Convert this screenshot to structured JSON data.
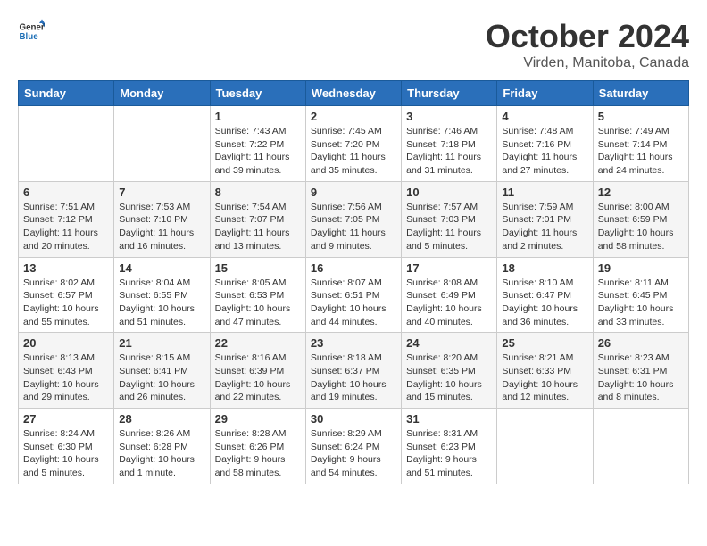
{
  "header": {
    "logo_line1": "General",
    "logo_line2": "Blue",
    "month": "October 2024",
    "location": "Virden, Manitoba, Canada"
  },
  "days_of_week": [
    "Sunday",
    "Monday",
    "Tuesday",
    "Wednesday",
    "Thursday",
    "Friday",
    "Saturday"
  ],
  "weeks": [
    [
      {
        "day": "",
        "info": ""
      },
      {
        "day": "",
        "info": ""
      },
      {
        "day": "1",
        "info": "Sunrise: 7:43 AM\nSunset: 7:22 PM\nDaylight: 11 hours and 39 minutes."
      },
      {
        "day": "2",
        "info": "Sunrise: 7:45 AM\nSunset: 7:20 PM\nDaylight: 11 hours and 35 minutes."
      },
      {
        "day": "3",
        "info": "Sunrise: 7:46 AM\nSunset: 7:18 PM\nDaylight: 11 hours and 31 minutes."
      },
      {
        "day": "4",
        "info": "Sunrise: 7:48 AM\nSunset: 7:16 PM\nDaylight: 11 hours and 27 minutes."
      },
      {
        "day": "5",
        "info": "Sunrise: 7:49 AM\nSunset: 7:14 PM\nDaylight: 11 hours and 24 minutes."
      }
    ],
    [
      {
        "day": "6",
        "info": "Sunrise: 7:51 AM\nSunset: 7:12 PM\nDaylight: 11 hours and 20 minutes."
      },
      {
        "day": "7",
        "info": "Sunrise: 7:53 AM\nSunset: 7:10 PM\nDaylight: 11 hours and 16 minutes."
      },
      {
        "day": "8",
        "info": "Sunrise: 7:54 AM\nSunset: 7:07 PM\nDaylight: 11 hours and 13 minutes."
      },
      {
        "day": "9",
        "info": "Sunrise: 7:56 AM\nSunset: 7:05 PM\nDaylight: 11 hours and 9 minutes."
      },
      {
        "day": "10",
        "info": "Sunrise: 7:57 AM\nSunset: 7:03 PM\nDaylight: 11 hours and 5 minutes."
      },
      {
        "day": "11",
        "info": "Sunrise: 7:59 AM\nSunset: 7:01 PM\nDaylight: 11 hours and 2 minutes."
      },
      {
        "day": "12",
        "info": "Sunrise: 8:00 AM\nSunset: 6:59 PM\nDaylight: 10 hours and 58 minutes."
      }
    ],
    [
      {
        "day": "13",
        "info": "Sunrise: 8:02 AM\nSunset: 6:57 PM\nDaylight: 10 hours and 55 minutes."
      },
      {
        "day": "14",
        "info": "Sunrise: 8:04 AM\nSunset: 6:55 PM\nDaylight: 10 hours and 51 minutes."
      },
      {
        "day": "15",
        "info": "Sunrise: 8:05 AM\nSunset: 6:53 PM\nDaylight: 10 hours and 47 minutes."
      },
      {
        "day": "16",
        "info": "Sunrise: 8:07 AM\nSunset: 6:51 PM\nDaylight: 10 hours and 44 minutes."
      },
      {
        "day": "17",
        "info": "Sunrise: 8:08 AM\nSunset: 6:49 PM\nDaylight: 10 hours and 40 minutes."
      },
      {
        "day": "18",
        "info": "Sunrise: 8:10 AM\nSunset: 6:47 PM\nDaylight: 10 hours and 36 minutes."
      },
      {
        "day": "19",
        "info": "Sunrise: 8:11 AM\nSunset: 6:45 PM\nDaylight: 10 hours and 33 minutes."
      }
    ],
    [
      {
        "day": "20",
        "info": "Sunrise: 8:13 AM\nSunset: 6:43 PM\nDaylight: 10 hours and 29 minutes."
      },
      {
        "day": "21",
        "info": "Sunrise: 8:15 AM\nSunset: 6:41 PM\nDaylight: 10 hours and 26 minutes."
      },
      {
        "day": "22",
        "info": "Sunrise: 8:16 AM\nSunset: 6:39 PM\nDaylight: 10 hours and 22 minutes."
      },
      {
        "day": "23",
        "info": "Sunrise: 8:18 AM\nSunset: 6:37 PM\nDaylight: 10 hours and 19 minutes."
      },
      {
        "day": "24",
        "info": "Sunrise: 8:20 AM\nSunset: 6:35 PM\nDaylight: 10 hours and 15 minutes."
      },
      {
        "day": "25",
        "info": "Sunrise: 8:21 AM\nSunset: 6:33 PM\nDaylight: 10 hours and 12 minutes."
      },
      {
        "day": "26",
        "info": "Sunrise: 8:23 AM\nSunset: 6:31 PM\nDaylight: 10 hours and 8 minutes."
      }
    ],
    [
      {
        "day": "27",
        "info": "Sunrise: 8:24 AM\nSunset: 6:30 PM\nDaylight: 10 hours and 5 minutes."
      },
      {
        "day": "28",
        "info": "Sunrise: 8:26 AM\nSunset: 6:28 PM\nDaylight: 10 hours and 1 minute."
      },
      {
        "day": "29",
        "info": "Sunrise: 8:28 AM\nSunset: 6:26 PM\nDaylight: 9 hours and 58 minutes."
      },
      {
        "day": "30",
        "info": "Sunrise: 8:29 AM\nSunset: 6:24 PM\nDaylight: 9 hours and 54 minutes."
      },
      {
        "day": "31",
        "info": "Sunrise: 8:31 AM\nSunset: 6:23 PM\nDaylight: 9 hours and 51 minutes."
      },
      {
        "day": "",
        "info": ""
      },
      {
        "day": "",
        "info": ""
      }
    ]
  ]
}
